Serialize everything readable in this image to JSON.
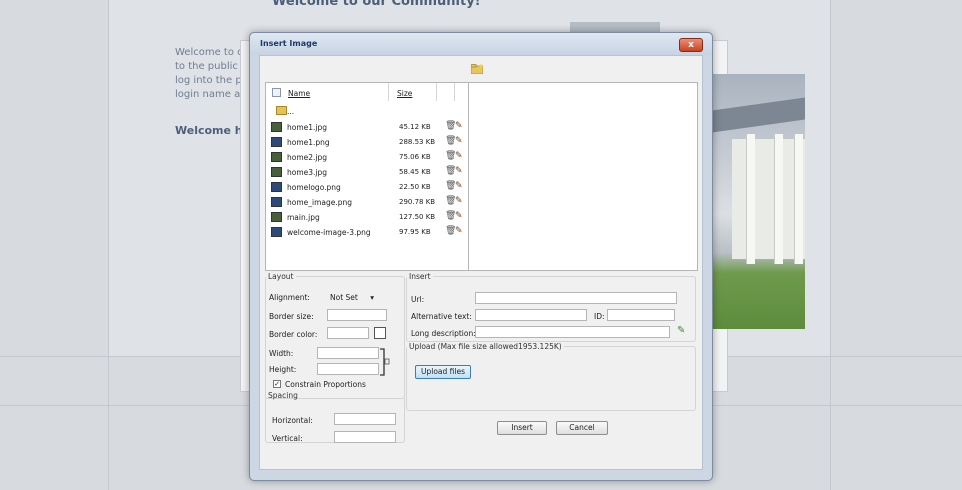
{
  "background": {
    "title": "Welcome to our Community!",
    "lines": [
      "Welcome to our",
      "to the public on",
      "log into the priv",
      "login name ar"
    ],
    "welcome_heading": "Welcome home"
  },
  "dialog": {
    "title": "Insert Image",
    "close_label": "x",
    "file_list": {
      "col_name": "Name",
      "col_size": "Size",
      "up_label": "...",
      "files": [
        {
          "name": "home1.jpg",
          "size": "45.12 KB",
          "type": "jpg"
        },
        {
          "name": "home1.png",
          "size": "288.53 KB",
          "type": "png"
        },
        {
          "name": "home2.jpg",
          "size": "75.06 KB",
          "type": "jpg"
        },
        {
          "name": "home3.jpg",
          "size": "58.45 KB",
          "type": "jpg"
        },
        {
          "name": "homelogo.png",
          "size": "22.50 KB",
          "type": "png"
        },
        {
          "name": "home_image.png",
          "size": "290.78 KB",
          "type": "png"
        },
        {
          "name": "main.jpg",
          "size": "127.50 KB",
          "type": "jpg"
        },
        {
          "name": "welcome-image-3.png",
          "size": "97.95 KB",
          "type": "png"
        }
      ]
    },
    "layout": {
      "legend": "Layout",
      "alignment_label": "Alignment:",
      "alignment_value": "Not Set",
      "border_size_label": "Border size:",
      "border_color_label": "Border color:",
      "width_label": "Width:",
      "height_label": "Height:",
      "constrain_label": "Constrain Proportions",
      "constrain_checked": true
    },
    "spacing": {
      "legend": "Spacing",
      "horizontal_label": "Horizontal:",
      "vertical_label": "Vertical:"
    },
    "insert": {
      "legend": "Insert",
      "url_label": "Url:",
      "alt_label": "Alternative text:",
      "id_label": "ID:",
      "long_desc_label": "Long description:"
    },
    "upload": {
      "legend": "Upload (Max file size allowed1953.125K)",
      "button_label": "Upload files"
    },
    "insert_button": "Insert",
    "cancel_button": "Cancel"
  }
}
